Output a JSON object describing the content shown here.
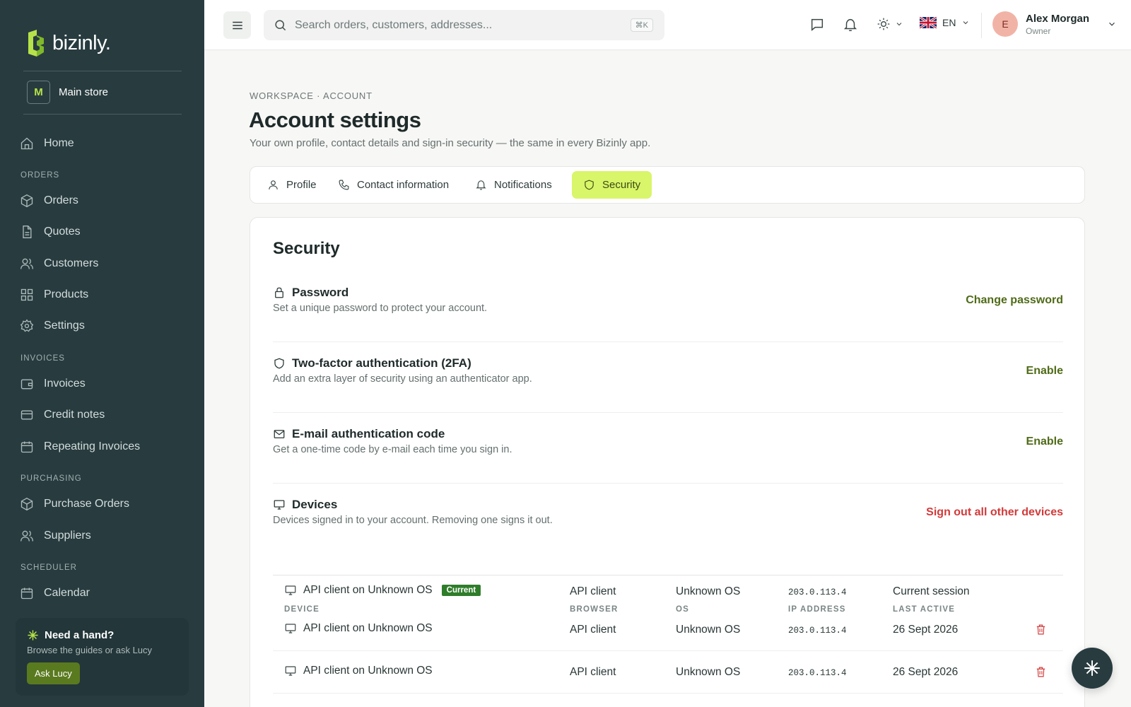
{
  "brand": {
    "name": "bizinly.",
    "accent": "#b7e34a"
  },
  "store": {
    "initial": "M",
    "name": "Main store"
  },
  "sidebar": {
    "home": "Home",
    "sections": {
      "orders": "ORDERS",
      "invoices": "INVOICES",
      "purchasing": "PURCHASING",
      "scheduler": "SCHEDULER"
    },
    "items": {
      "orders": "Orders",
      "quotes": "Quotes",
      "customers": "Customers",
      "products": "Products",
      "settings": "Settings",
      "invoices": "Invoices",
      "credit_notes": "Credit notes",
      "repeating_invoices": "Repeating Invoices",
      "purchase_orders": "Purchase Orders",
      "suppliers": "Suppliers",
      "calendar": "Calendar"
    },
    "help": {
      "title": "Need a hand?",
      "subtitle": "Browse the guides or ask Lucy",
      "button": "Ask Lucy"
    }
  },
  "topbar": {
    "search_placeholder": "Search orders, customers, addresses...",
    "search_shortcut": "⌘K",
    "language": "EN",
    "user": {
      "initial": "E",
      "name": "Alex Morgan",
      "role": "Owner"
    }
  },
  "page": {
    "breadcrumb": "WORKSPACE · ACCOUNT",
    "title": "Account settings",
    "subtitle": "Your own profile, contact details and sign-in security — the same in every Bizinly app."
  },
  "tabs": [
    {
      "label": "Profile",
      "active": false
    },
    {
      "label": "Contact information",
      "active": false
    },
    {
      "label": "Notifications",
      "active": false
    },
    {
      "label": "Security",
      "active": true
    }
  ],
  "security": {
    "title": "Security",
    "password": {
      "title": "Password",
      "description": "Set a unique password to protect your account.",
      "action": "Change password"
    },
    "two_factor": {
      "title": "Two-factor authentication (2FA)",
      "description": "Add an extra layer of security using an authenticator app.",
      "action": "Enable"
    },
    "email_code": {
      "title": "E-mail authentication code",
      "description": "Get a one-time code by e-mail each time you sign in.",
      "action": "Enable"
    },
    "devices": {
      "title": "Devices",
      "description": "Devices signed in to your account. Removing one signs it out.",
      "action": "Sign out all other devices",
      "current_badge": "Current",
      "headers": {
        "device": "DEVICE",
        "browser": "BROWSER",
        "os": "OS",
        "ip": "IP ADDRESS",
        "last_active": "LAST ACTIVE"
      },
      "rows": [
        {
          "device": "API client on Unknown OS",
          "browser": "API client",
          "os": "Unknown OS",
          "ip": "203.0.113.4",
          "last_active": "Current session"
        },
        {
          "device": "API client on Unknown OS",
          "browser": "API client",
          "os": "Unknown OS",
          "ip": "203.0.113.4",
          "last_active": "26 Sept 2026"
        },
        {
          "device": "API client on Unknown OS",
          "browser": "API client",
          "os": "Unknown OS",
          "ip": "203.0.113.4",
          "last_active": "26 Sept 2026"
        }
      ]
    }
  },
  "colors": {
    "sidebar_bg": "#283c40",
    "active_tab": "#d9f56a",
    "link_green": "#4f6b17",
    "danger": "#d23a3a",
    "current_badge": "#2f7d2a"
  }
}
